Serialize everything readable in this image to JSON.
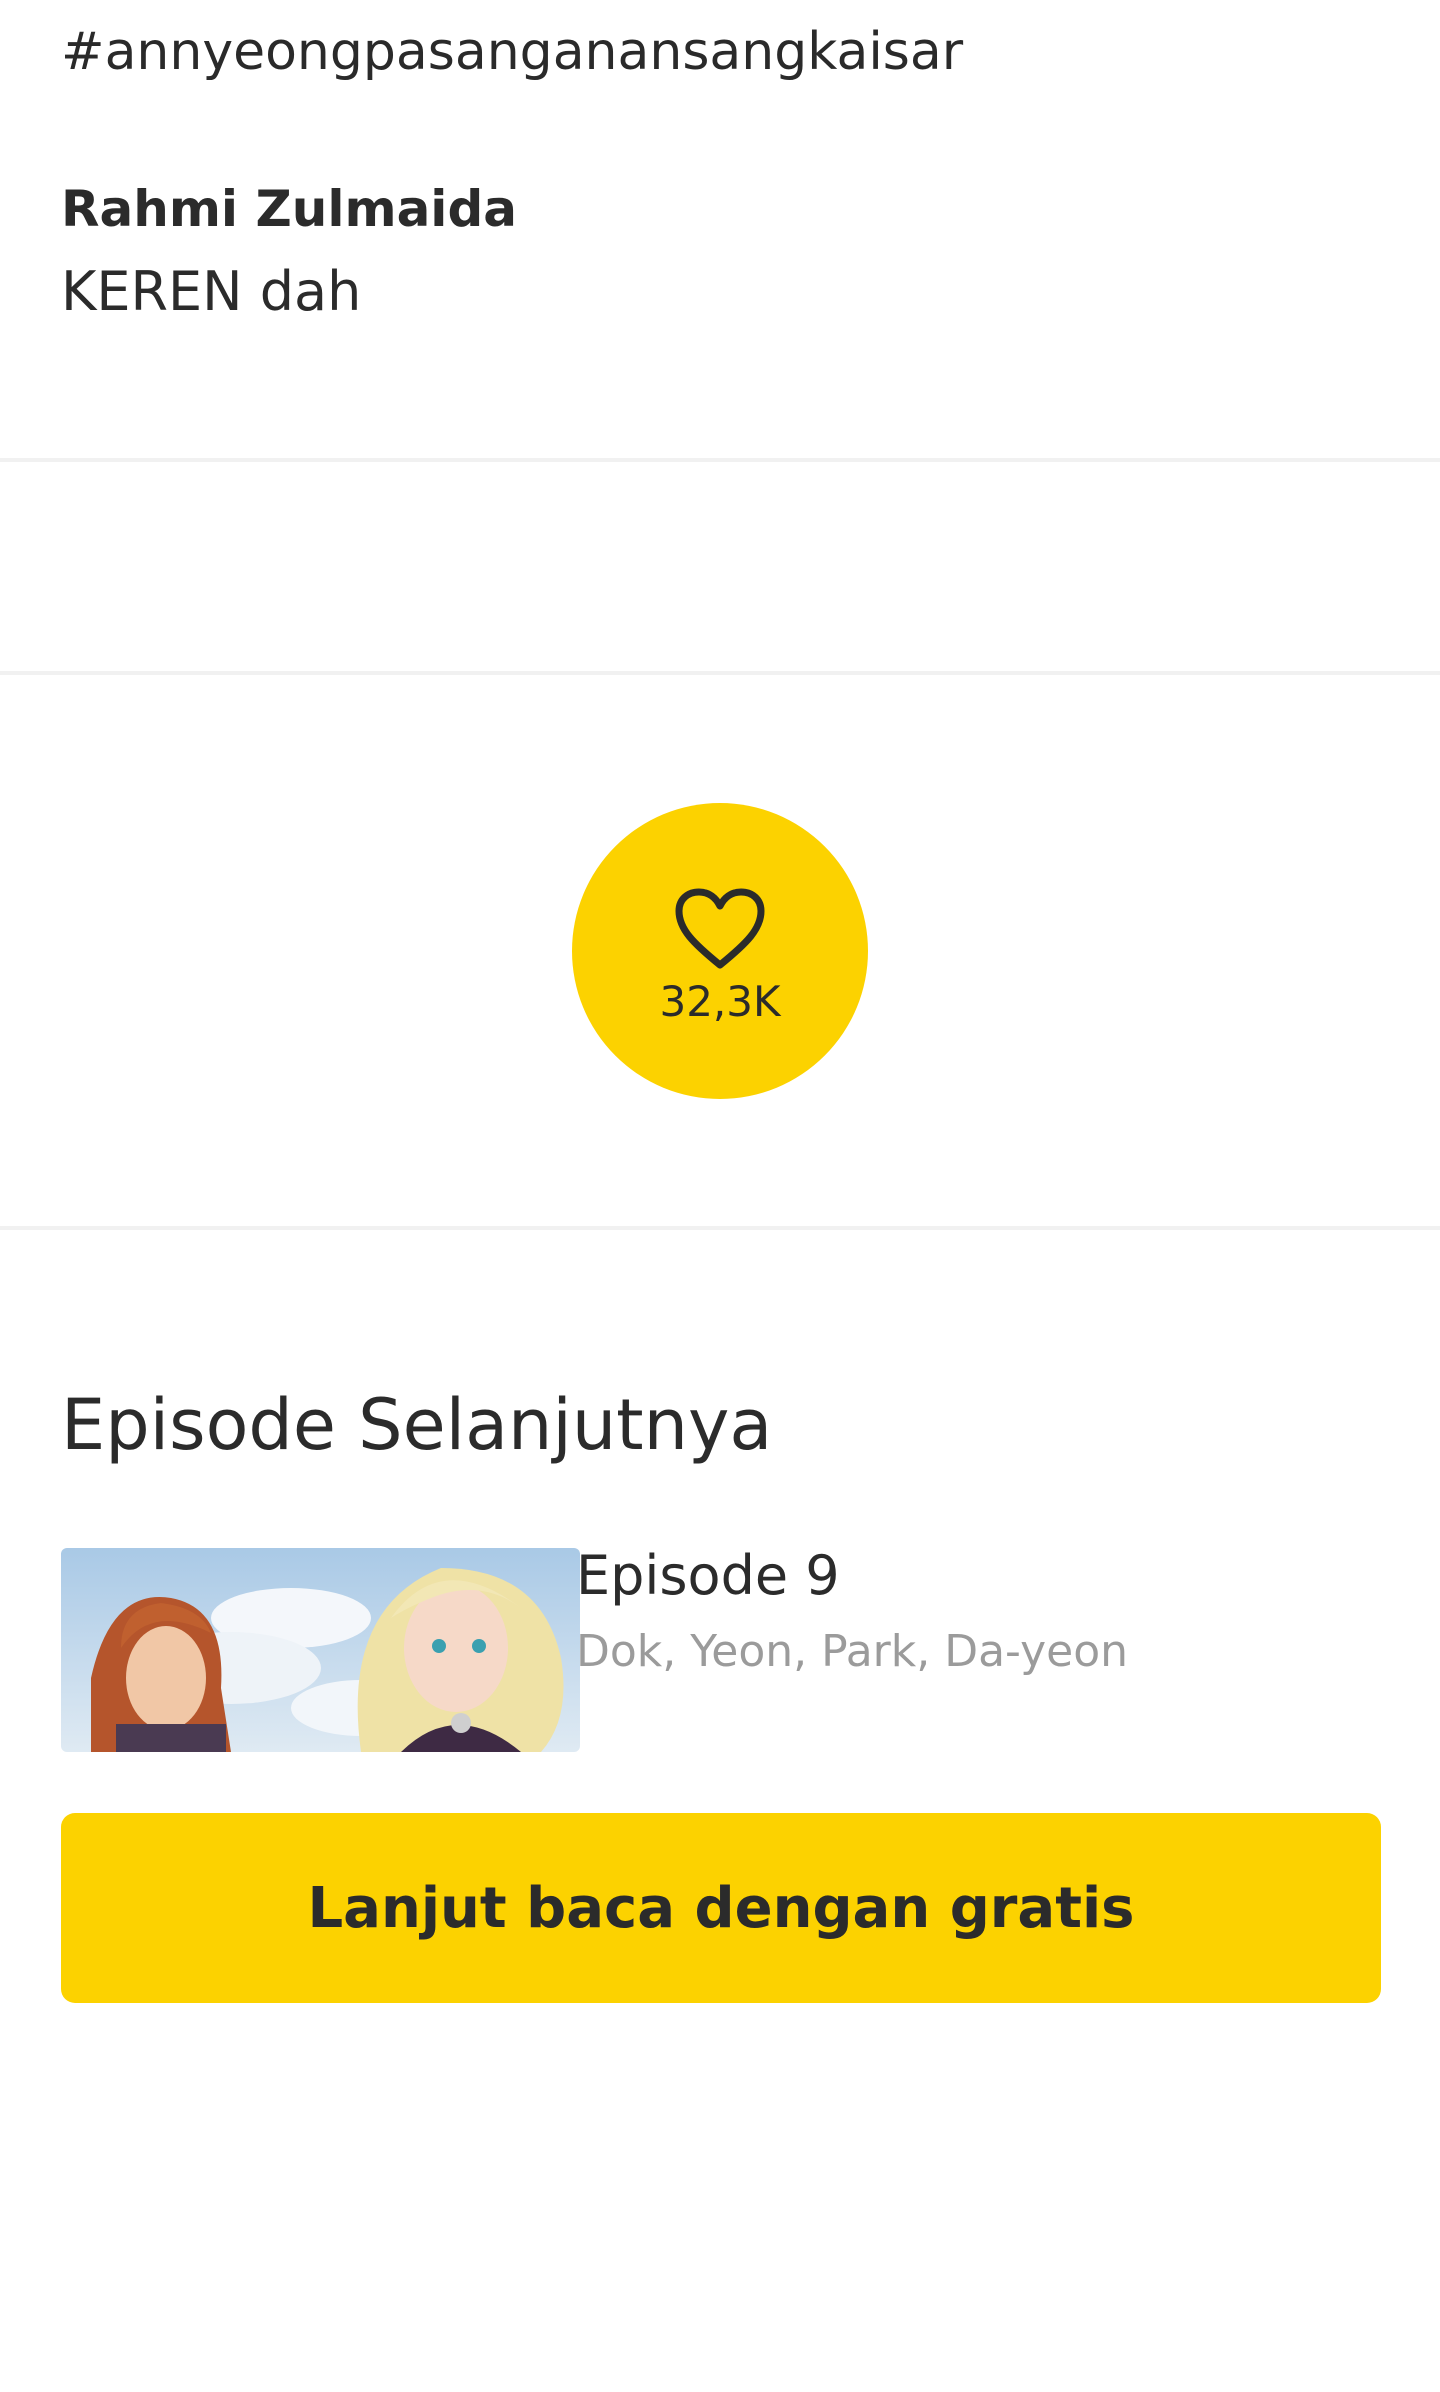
{
  "hashtag": "#annyeongpasanganansangkaisar",
  "comment": {
    "author": "Rahmi Zulmaida",
    "text": "KEREN dah"
  },
  "like": {
    "icon": "heart-icon",
    "count": "32,3K",
    "color": "#fcd200"
  },
  "next_episode": {
    "section_title": "Episode Selanjutnya",
    "title": "Episode 9",
    "authors": "Dok, Yeon, Park, Da-yeon"
  },
  "cta": {
    "label": "Lanjut baca dengan gratis",
    "color": "#fcd200"
  }
}
